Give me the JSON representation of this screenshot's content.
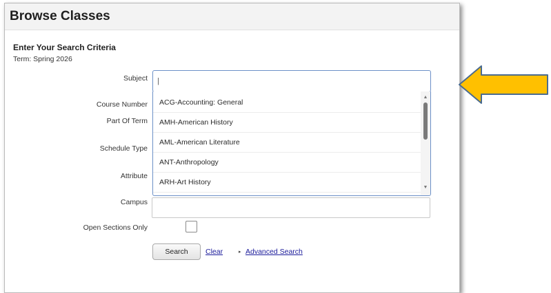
{
  "page": {
    "title": "Browse Classes"
  },
  "form": {
    "section_title": "Enter Your Search Criteria",
    "term": "Term: Spring 2026",
    "labels": {
      "subject": "Subject",
      "course_number": "Course Number",
      "part_of_term": "Part Of Term",
      "schedule_type": "Schedule Type",
      "attribute": "Attribute",
      "campus": "Campus",
      "open_sections_only": "Open Sections Only"
    },
    "subject_value": "|",
    "open_sections_only_checked": false
  },
  "subject_dropdown": {
    "options": [
      "ACG-Accounting: General",
      "AMH-American History",
      "AML-American Literature",
      "ANT-Anthropology",
      "ARH-Art History"
    ]
  },
  "actions": {
    "search_label": "Search",
    "clear_label": "Clear",
    "advanced_label": "Advanced Search"
  },
  "colors": {
    "arrow_fill": "#ffc000",
    "arrow_stroke": "#4a6b8f",
    "link": "#1a1a9a",
    "focus_border": "#6b8fc7"
  },
  "icons": {
    "advanced_caret": "▸",
    "scroll_up": "▲",
    "scroll_down": "▼"
  }
}
